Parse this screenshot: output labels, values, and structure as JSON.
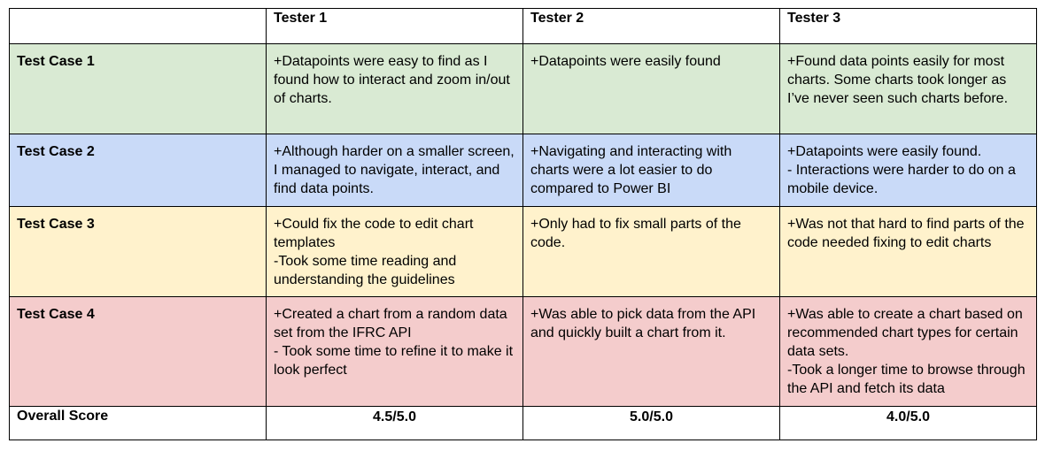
{
  "table": {
    "corner": "",
    "headers": [
      "Tester 1",
      "Tester 2",
      "Tester 3"
    ],
    "rows": [
      {
        "label": "Test Case 1",
        "color": "#d9ead3",
        "cells": [
          "+Datapoints were easy to find as I found how to interact and zoom in/out of charts.",
          "+Datapoints were easily found",
          "+Found data points easily for most charts. Some charts took longer as I’ve never seen such charts before."
        ]
      },
      {
        "label": "Test Case 2",
        "color": "#c9daf8",
        "cells": [
          "+Although harder on a smaller screen, I managed to navigate, interact, and find data points.",
          "+Navigating and interacting with charts were a lot easier to do compared to Power BI",
          "+Datapoints were easily found.\n- Interactions were harder to do on a mobile device."
        ]
      },
      {
        "label": "Test Case 3",
        "color": "#fff2cc",
        "cells": [
          "+Could fix the code to edit chart templates\n-Took some time reading and understanding the guidelines",
          "+Only had to fix small parts of the code.",
          "+Was not that hard to find parts of the code needed fixing to edit charts"
        ]
      },
      {
        "label": "Test Case 4",
        "color": "#f4cccc",
        "cells": [
          "+Created a chart from a random data set from the IFRC API\n- Took some time to refine it to make it look perfect",
          "+Was able to pick data from the API and quickly built a chart from it.",
          "+Was able to create a chart based on recommended chart types for certain data sets.\n-Took a longer time to browse through the API and fetch its data"
        ]
      }
    ],
    "score": {
      "label": "Overall Score",
      "values": [
        "4.5/5.0",
        "5.0/5.0",
        "4.0/5.0"
      ]
    }
  }
}
